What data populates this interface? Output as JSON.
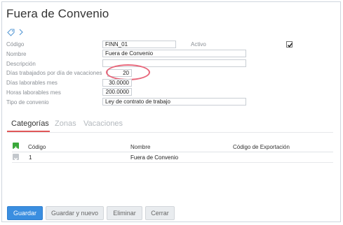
{
  "page": {
    "title": "Fuera de Convenio"
  },
  "form": {
    "codigo": {
      "label": "Código",
      "value": "FINN_01"
    },
    "activo": {
      "label": "Activo",
      "checked": true
    },
    "nombre": {
      "label": "Nombre",
      "value": "Fuera de Convenio"
    },
    "descripcion": {
      "label": "Descripción",
      "value": ""
    },
    "dias_vacaciones": {
      "label": "Días trabajados por día de vacaciones",
      "value": "20"
    },
    "dias_laborables": {
      "label": "Días laborables mes",
      "value": "30.0000"
    },
    "horas_laborables": {
      "label": "Horas laborables mes",
      "value": "200.0000"
    },
    "tipo_convenio": {
      "label": "Tipo de convenio",
      "value": "Ley de contrato de trabajo"
    }
  },
  "tabs": [
    {
      "label": "Categorías",
      "active": true
    },
    {
      "label": "Zonas",
      "active": false
    },
    {
      "label": "Vacaciones",
      "active": false
    }
  ],
  "grid": {
    "columns": [
      "Código",
      "Nombre",
      "Código de Exportación"
    ],
    "rows": [
      {
        "codigo": "1",
        "nombre": "Fuera de Convenio",
        "exportacion": ""
      }
    ]
  },
  "buttons": {
    "guardar": "Guardar",
    "guardar_nuevo": "Guardar y nuevo",
    "eliminar": "Eliminar",
    "cerrar": "Cerrar"
  },
  "colors": {
    "accent": "#3a8ee0",
    "tab_underline": "#e05757",
    "add": "#3aa83a",
    "highlight": "#e8667a"
  }
}
